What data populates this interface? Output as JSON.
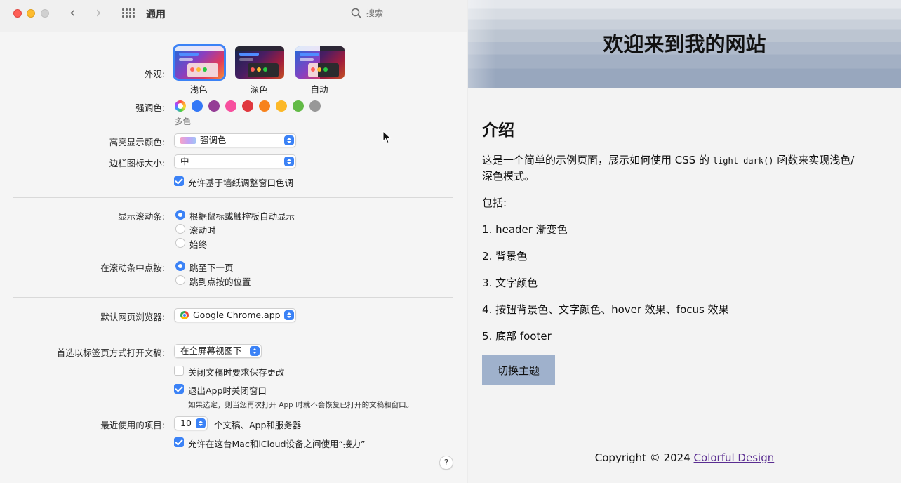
{
  "prefs": {
    "title": "通用",
    "search_placeholder": "搜索",
    "appearance": {
      "label": "外观:",
      "options": [
        "浅色",
        "深色",
        "自动"
      ],
      "selected": "浅色"
    },
    "accent": {
      "label": "强调色:",
      "caption": "多色",
      "colors": [
        "multicolor",
        "#3478f6",
        "#953d96",
        "#f74f9e",
        "#e0383e",
        "#f7821b",
        "#fcb827",
        "#62ba46",
        "#989898"
      ]
    },
    "highlight": {
      "label": "高亮显示颜色:",
      "value": "强调色"
    },
    "sidebar_icon": {
      "label": "边栏图标大小:",
      "value": "中"
    },
    "wallpaper_tint": {
      "label": "允许基于墙纸调整窗口色调",
      "checked": true
    },
    "scrollbars": {
      "label": "显示滚动条:",
      "options": [
        "根据鼠标或触控板自动显示",
        "滚动时",
        "始终"
      ],
      "selected": "根据鼠标或触控板自动显示"
    },
    "scroll_click": {
      "label": "在滚动条中点按:",
      "options": [
        "跳至下一页",
        "跳到点按的位置"
      ],
      "selected": "跳至下一页"
    },
    "browser": {
      "label": "默认网页浏览器:",
      "value": "Google Chrome.app"
    },
    "tabs": {
      "label": "首选以标签页方式打开文稿:",
      "value": "在全屏幕视图下"
    },
    "ask_save": {
      "label": "关闭文稿时要求保存更改",
      "checked": false
    },
    "close_windows": {
      "label": "退出App时关闭窗口",
      "checked": true,
      "note": "如果选定，则当您再次打开 App 时就不会恢复已打开的文稿和窗口。"
    },
    "recent": {
      "label": "最近使用的项目:",
      "value": "10",
      "suffix": "个文稿、App和服务器"
    },
    "handoff": {
      "label": "允许在这台Mac和iCloud设备之间使用“接力”",
      "checked": true
    },
    "help": "?"
  },
  "web": {
    "header_title": "欢迎来到我的网站",
    "section_title": "介绍",
    "intro_line1_a": "这是一个简单的示例页面，展示如何使用 CSS 的 ",
    "intro_code": "light-dark()",
    "intro_line1_b": " 函数来实现浅色/",
    "intro_line2": "深色模式。",
    "includes": "包括:",
    "items": [
      "1. header 渐变色",
      "2. 背景色",
      "3. 文字颜色",
      "4. 按钮背景色、文字颜色、hover 效果、focus 效果",
      "5. 底部 footer"
    ],
    "button": "切换主题",
    "footer_text": "Copyright © 2024 ",
    "footer_link": "Colorful Design"
  }
}
